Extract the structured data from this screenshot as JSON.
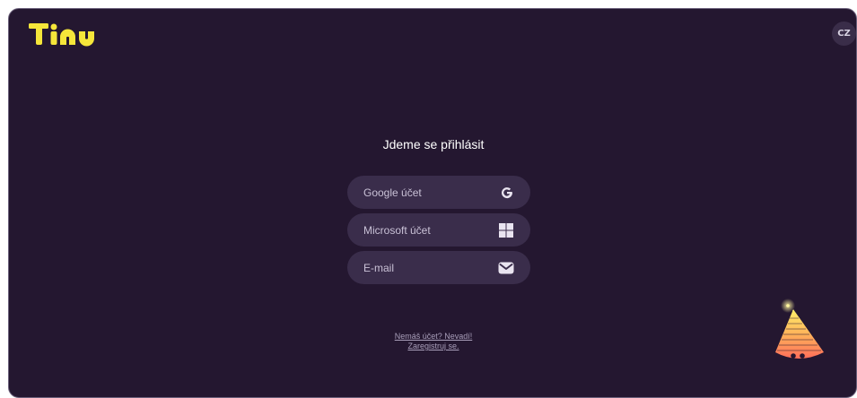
{
  "brand": {
    "name": "Tinu",
    "color": "#f5e63a"
  },
  "header": {
    "language": "CZ"
  },
  "login": {
    "title": "Jdeme se přihlásit",
    "options": [
      {
        "label": "Google účet",
        "icon": "google-icon"
      },
      {
        "label": "Microsoft účet",
        "icon": "windows-icon"
      },
      {
        "label": "E-mail",
        "icon": "envelope-icon"
      }
    ]
  },
  "register": {
    "line1": "Nemáš účet? Nevadí!",
    "line2": "Zaregistruj se."
  },
  "colors": {
    "background": "#241730",
    "button": "#3a2d4b",
    "accent_yellow": "#f5e63a",
    "mascot_gradient": [
      "#fff06a",
      "#ff7a5c"
    ]
  }
}
